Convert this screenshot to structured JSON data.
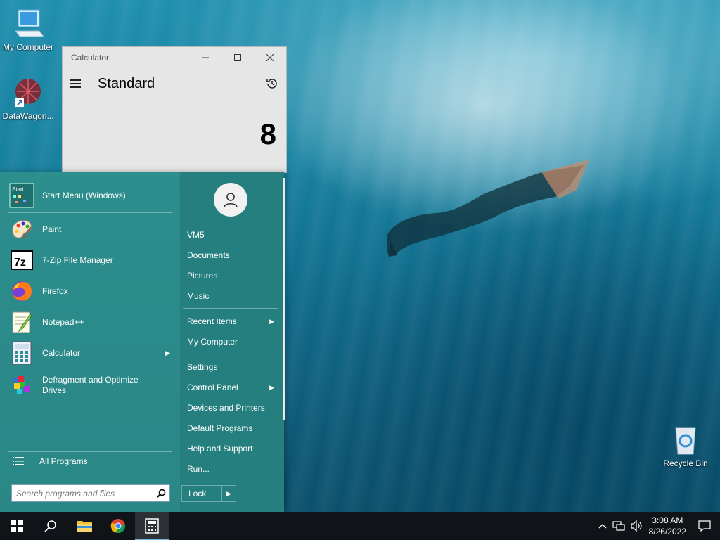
{
  "desktop": {
    "icons": [
      {
        "label": "My Computer"
      },
      {
        "label": "DataWagon..."
      },
      {
        "label": "Recycle Bin"
      }
    ]
  },
  "calculator": {
    "window_title": "Calculator",
    "mode": "Standard",
    "display": "8"
  },
  "start_menu": {
    "pinned": [
      {
        "label": "Start Menu (Windows)",
        "icon": "start-menu-icon"
      },
      {
        "label": "Paint",
        "icon": "paint-icon"
      },
      {
        "label": "7-Zip File Manager",
        "icon": "7zip-icon"
      },
      {
        "label": "Firefox",
        "icon": "firefox-icon"
      },
      {
        "label": "Notepad++",
        "icon": "notepad-plus-plus-icon"
      },
      {
        "label": "Calculator",
        "icon": "calculator-icon",
        "has_submenu": true
      },
      {
        "label": "Defragment and Optimize\nDrives",
        "icon": "defrag-icon"
      }
    ],
    "start_icon_text": "Start",
    "sevenzip_icon_text": "7z",
    "all_programs": "All Programs",
    "search_placeholder": "Search programs and files",
    "right": {
      "user": "VM5",
      "documents": "Documents",
      "pictures": "Pictures",
      "music": "Music",
      "recent_items": "Recent Items",
      "my_computer": "My Computer",
      "settings": "Settings",
      "control_panel": "Control Panel",
      "devices_printers": "Devices and Printers",
      "default_programs": "Default Programs",
      "help_support": "Help and Support",
      "run": "Run..."
    },
    "lock": "Lock"
  },
  "taskbar": {
    "time": "3:08 AM",
    "date": "8/26/2022"
  }
}
